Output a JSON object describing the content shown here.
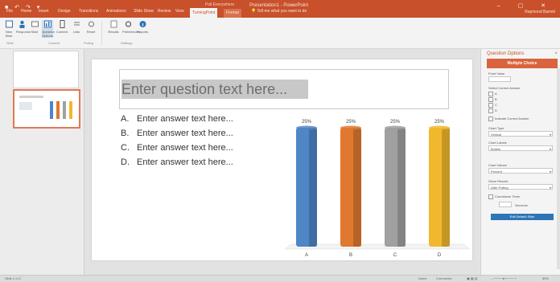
{
  "window": {
    "document_title": "Presentation1 - PowerPoint",
    "contextual_group": "Poll Everywhere",
    "user": "Raymond Barrett",
    "tell_me": "Tell me what you want to do"
  },
  "tabs": [
    "File",
    "Home",
    "Insert",
    "Design",
    "Transitions",
    "Animations",
    "Slide Show",
    "Review",
    "View",
    "TurningPoint",
    "Format"
  ],
  "active_tab_index": 9,
  "ribbon": {
    "buttons": [
      "New Slide",
      "Response",
      "Slide",
      "Question Options",
      "Content",
      "Lists",
      "Reset",
      "Results",
      "Preferences",
      "Reports"
    ],
    "groups": [
      "Slide",
      "Content",
      "Polling",
      "Settings"
    ]
  },
  "slide": {
    "question_placeholder": "Enter question text here...",
    "answers": [
      {
        "letter": "A.",
        "text": "Enter answer text here..."
      },
      {
        "letter": "B.",
        "text": "Enter answer text here..."
      },
      {
        "letter": "C.",
        "text": "Enter answer text here..."
      },
      {
        "letter": "D.",
        "text": "Enter answer text here..."
      }
    ]
  },
  "chart_data": {
    "type": "bar",
    "categories": [
      "A",
      "B",
      "C",
      "D"
    ],
    "values": [
      25,
      25,
      25,
      25
    ],
    "data_labels": [
      "25%",
      "25%",
      "25%",
      "25%"
    ],
    "colors": [
      "#4f86c6",
      "#e0782f",
      "#a0a0a0",
      "#f1b82d"
    ],
    "ylim": [
      0,
      25
    ],
    "grid": false
  },
  "taskpane": {
    "title": "Question Options",
    "close": "×",
    "header": "Multiple Choice",
    "point_value_label": "Point Value",
    "point_value": "",
    "correct_answer_label": "Select Correct Answer",
    "answers": [
      "A",
      "B",
      "C",
      "D"
    ],
    "indicate_label": "Indicate Correct Answer",
    "chart_type_label": "Chart Type",
    "chart_type_value": "Vertical",
    "chart_labels_label": "Chart Labels",
    "chart_labels_value": "Bullets",
    "chart_values_label": "Chart Values",
    "chart_values_value": "Percent",
    "show_results_label": "Show Results",
    "show_results_value": "After Polling",
    "countdown_label": "Countdown Timer",
    "seconds_value": "",
    "seconds_label": "Seconds",
    "button_label": "Edit Default Slide"
  },
  "statusbar": {
    "slide_info": "Slide 2 of 2",
    "notes": "Notes",
    "comments": "Comments",
    "zoom": "85%"
  },
  "accent_color": "#c8502a"
}
